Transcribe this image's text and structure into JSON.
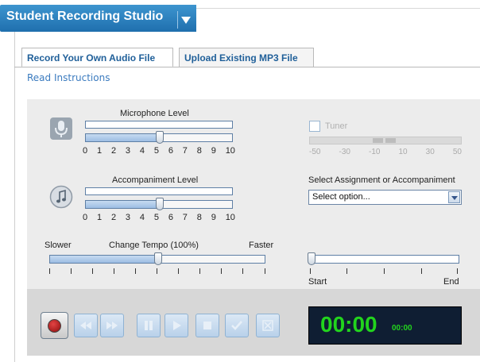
{
  "app": {
    "title": "Student Recording Studio"
  },
  "tabs": [
    {
      "label": "Record Your Own Audio File",
      "active": true
    },
    {
      "label": "Upload Existing MP3 File",
      "active": false
    }
  ],
  "links": {
    "read_instructions": "Read Instructions"
  },
  "microphone": {
    "label": "Microphone Level",
    "level": 5,
    "scale": [
      "0",
      "1",
      "2",
      "3",
      "4",
      "5",
      "6",
      "7",
      "8",
      "9",
      "10"
    ],
    "icon": "microphone-icon"
  },
  "accompaniment": {
    "label": "Accompaniment Level",
    "level": 5,
    "scale": [
      "0",
      "1",
      "2",
      "3",
      "4",
      "5",
      "6",
      "7",
      "8",
      "9",
      "10"
    ],
    "icon": "music-note-icon"
  },
  "tempo": {
    "label": "Change Tempo (100%)",
    "slower": "Slower",
    "faster": "Faster",
    "value": 100,
    "scale": [
      "50",
      "60",
      "70",
      "80",
      "90",
      "100",
      "110",
      "120",
      "130",
      "140",
      "150"
    ]
  },
  "tuner": {
    "label": "Tuner",
    "checked": false,
    "scale": [
      "-50",
      "-30",
      "-10",
      "10",
      "30",
      "50"
    ]
  },
  "assignment": {
    "label": "Select Assignment or Accompaniment",
    "selected": "Select option..."
  },
  "position": {
    "start_label": "Start",
    "end_label": "End",
    "fraction": 0
  },
  "timer": {
    "main": "00:00",
    "sub": "00:00"
  },
  "transport": [
    {
      "name": "record-button",
      "icon": "record-icon",
      "enabled": true
    },
    {
      "name": "rewind-button",
      "icon": "rewind-icon",
      "enabled": false
    },
    {
      "name": "fast-forward-button",
      "icon": "fast-forward-icon",
      "enabled": false
    },
    {
      "name": "pause-button",
      "icon": "pause-icon",
      "enabled": false
    },
    {
      "name": "play-button",
      "icon": "play-icon",
      "enabled": false
    },
    {
      "name": "stop-button",
      "icon": "stop-icon",
      "enabled": false
    },
    {
      "name": "accept-button",
      "icon": "checkmark-icon",
      "enabled": false
    },
    {
      "name": "delete-button",
      "icon": "delete-icon",
      "enabled": false
    }
  ],
  "colors": {
    "accent": "#1f6fae",
    "timer_text": "#22d41d",
    "timer_bg": "#0f1e33"
  }
}
